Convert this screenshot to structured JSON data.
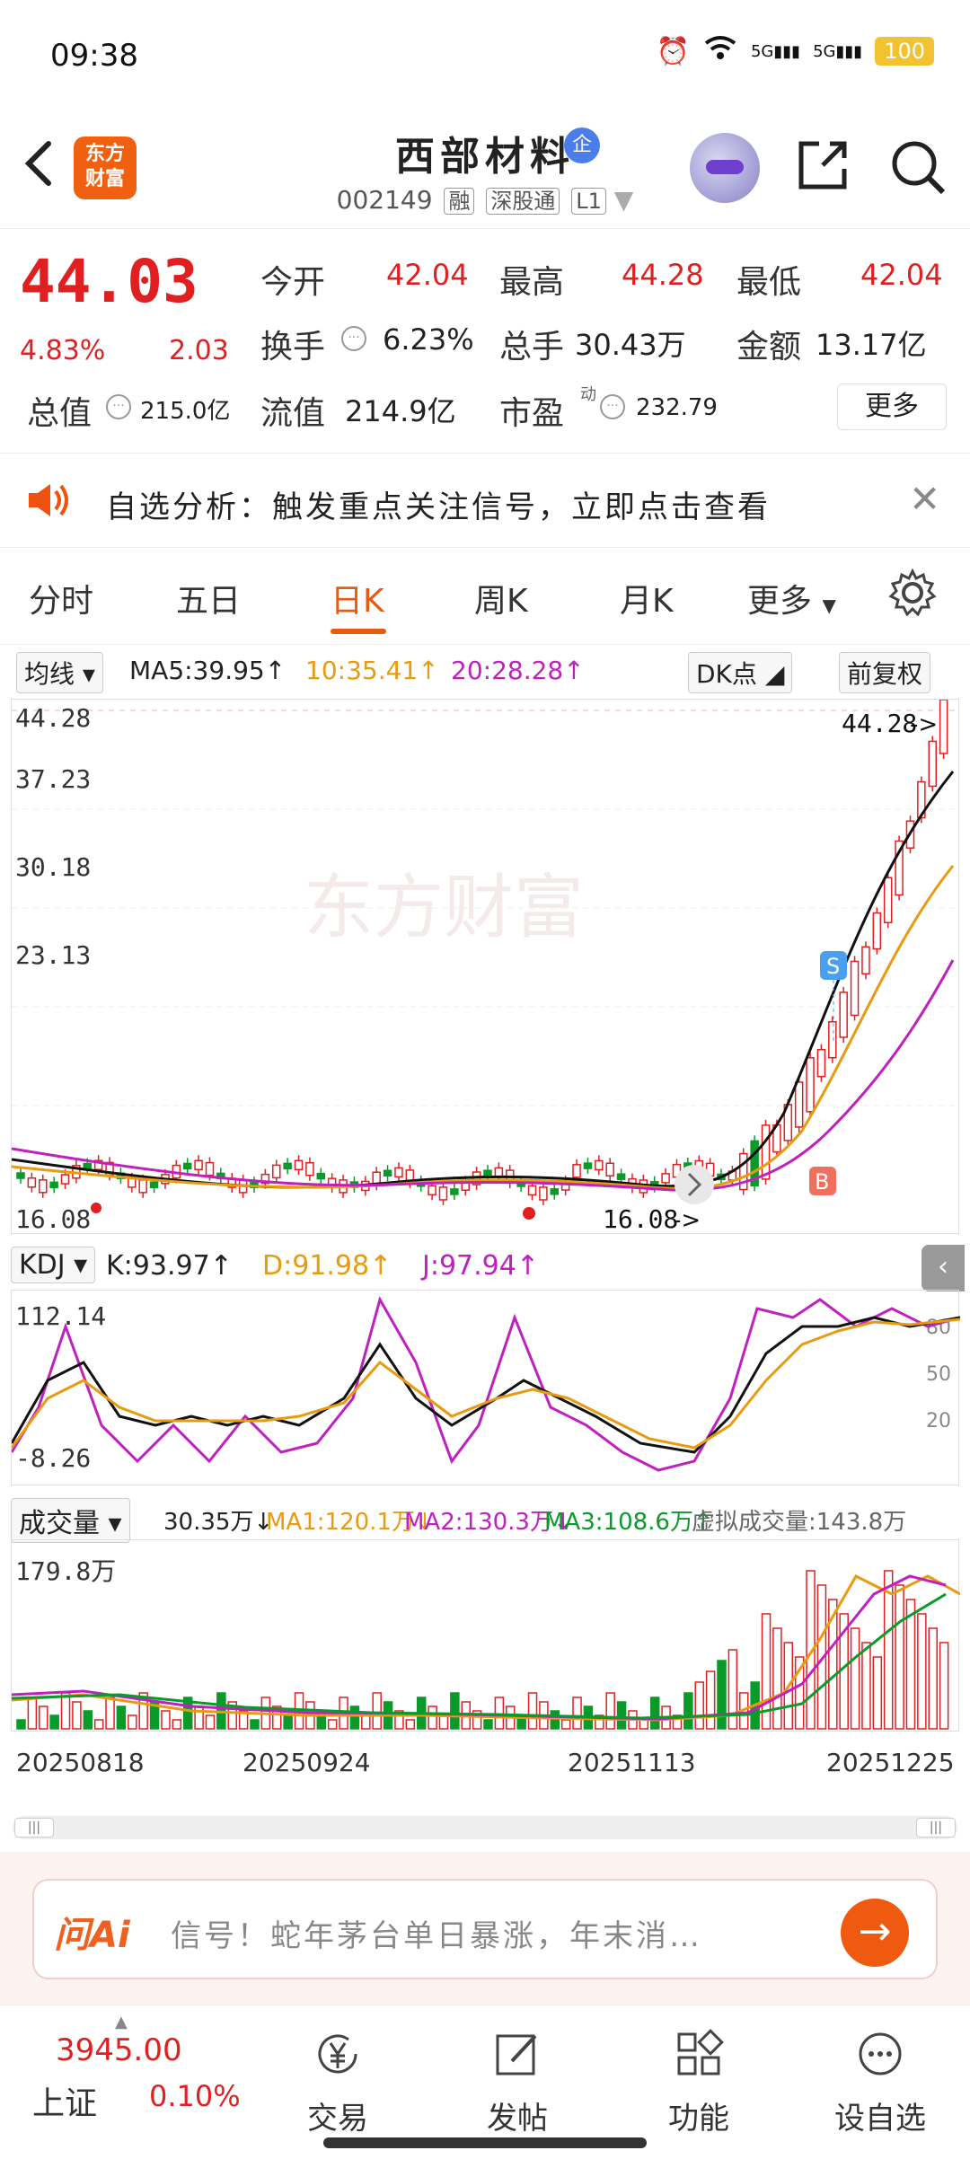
{
  "status": {
    "time": "09:38",
    "battery": "100",
    "net1": "5G",
    "net2": "5G"
  },
  "nav": {
    "stock_name": "西部材料",
    "badge": "企",
    "code": "002149",
    "tags": [
      "融",
      "深股通",
      "L1"
    ],
    "logo_line1": "东方",
    "logo_line2": "财富"
  },
  "quote": {
    "price": "44.03",
    "change_pct": "4.83%",
    "change_amt": "2.03",
    "open_label": "今开",
    "open": "42.04",
    "high_label": "最高",
    "high": "44.28",
    "low_label": "最低",
    "low": "42.04",
    "turnover_label": "换手",
    "turnover": "6.23%",
    "volume_label": "总手",
    "volume": "30.43万",
    "amount_label": "金额",
    "amount": "13.17亿",
    "mktcap_label": "总值",
    "mktcap": "215.0亿",
    "float_label": "流值",
    "float": "214.9亿",
    "pe_label": "市盈",
    "pe_sup": "动",
    "pe": "232.79",
    "more": "更多"
  },
  "banner": {
    "text": "自选分析：触发重点关注信号，立即点击查看"
  },
  "tabs": [
    "分时",
    "五日",
    "日K",
    "周K",
    "月K",
    "更多"
  ],
  "ma": {
    "select": "均线",
    "ma5": "MA5:39.95↑",
    "ma10": "10:35.41↑",
    "ma20": "20:28.28↑",
    "dk": "DK点",
    "adjust": "前复权"
  },
  "kchart": {
    "y_labels": [
      "44.28",
      "37.23",
      "30.18",
      "23.13",
      "16.08"
    ],
    "high_marker": "44.28",
    "low_marker": "16.08",
    "watermark": "东方财富",
    "sell_marker": "S",
    "buy_marker": "B"
  },
  "kdj": {
    "select": "KDJ",
    "k": "K:93.97↑",
    "d": "D:91.98↑",
    "j": "J:97.94↑",
    "top": "112.14",
    "bottom": "-8.26",
    "lv80": "80",
    "lv50": "50",
    "lv20": "20"
  },
  "vol": {
    "select": "成交量",
    "v": "30.35万↓",
    "ma1": "MA1:120.1万↓",
    "ma2": "MA2:130.3万↓",
    "ma3": "MA3:108.6万↑",
    "virtual": "虚拟成交量:143.8万",
    "top": "179.8万"
  },
  "dates": [
    "20250818",
    "20250924",
    "20251113",
    "20251225"
  ],
  "ai": {
    "logo": "问Ai",
    "text": "信号！蛇年茅台单日暴涨，年末消…"
  },
  "bottom": {
    "index_value": "3945.00",
    "index_name": "上证",
    "index_pct": "0.10%",
    "items": [
      "交易",
      "发帖",
      "功能",
      "设自选"
    ]
  },
  "colors": {
    "up": "#e02020",
    "down": "#0a9a2a",
    "accent": "#e85a10",
    "ma10": "#e89a10",
    "ma20": "#c020c0"
  }
}
